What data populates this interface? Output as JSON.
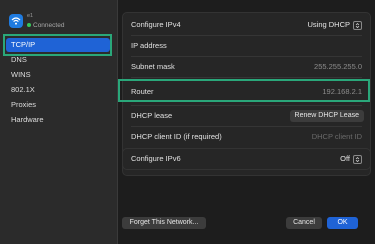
{
  "network": {
    "name": "e1",
    "status": "Connected",
    "status_color": "#35c759"
  },
  "sidebar": {
    "items": [
      {
        "label": "TCP/IP",
        "selected": true
      },
      {
        "label": "DNS"
      },
      {
        "label": "WINS"
      },
      {
        "label": "802.1X"
      },
      {
        "label": "Proxies"
      },
      {
        "label": "Hardware"
      }
    ]
  },
  "ipv4": {
    "configure_label": "Configure IPv4",
    "configure_value": "Using DHCP",
    "ip_label": "IP address",
    "ip_value": "",
    "subnet_label": "Subnet mask",
    "subnet_value": "255.255.255.0",
    "router_label": "Router",
    "router_value": "192.168.2.1",
    "dhcp_lease_label": "DHCP lease",
    "renew_button": "Renew DHCP Lease",
    "client_id_label": "DHCP client ID (if required)",
    "client_id_placeholder": "DHCP client ID"
  },
  "ipv6": {
    "configure_label": "Configure IPv6",
    "configure_value": "Off"
  },
  "footer": {
    "forget_button": "Forget This Network...",
    "cancel_button": "Cancel",
    "ok_button": "OK"
  },
  "colors": {
    "accent": "#1f63d6",
    "highlight": "#2aa77a",
    "wifi_icon_bg": "#1f7be0"
  }
}
